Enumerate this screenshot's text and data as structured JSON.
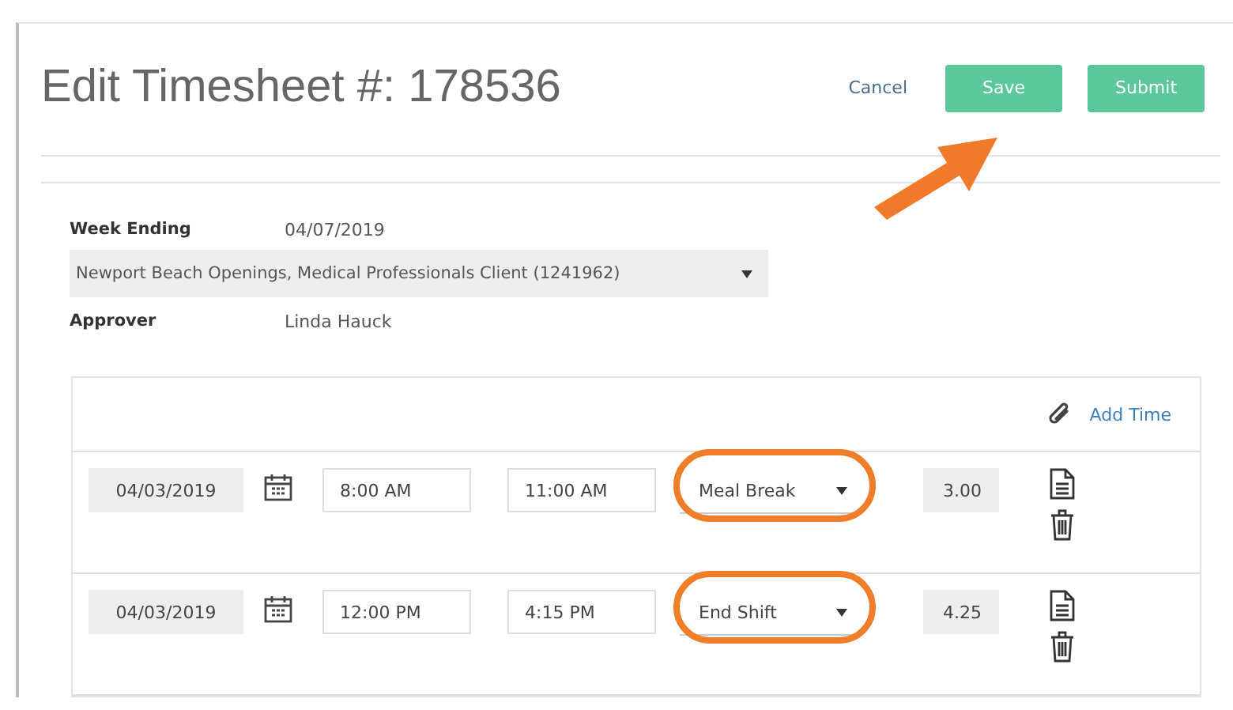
{
  "header": {
    "title": "Edit Timesheet #: 178536",
    "cancel": "Cancel",
    "buttons": [
      "Save",
      "Submit"
    ]
  },
  "details": {
    "week_ending_label": "Week Ending",
    "week_ending": "04/07/2019",
    "assignment": "Newport Beach Openings, Medical Professionals Client (1241962)",
    "approver_label": "Approver",
    "approver": "Linda Hauck"
  },
  "time_entries": {
    "add_time": "Add Time",
    "rows": [
      {
        "date": "04/03/2019",
        "start": "8:00 AM",
        "end": "11:00 AM",
        "type": "Meal Break",
        "hours": "3.00",
        "highlighted": true
      },
      {
        "date": "04/03/2019",
        "start": "12:00 PM",
        "end": "4:15 PM",
        "type": "End Shift",
        "hours": "4.25",
        "highlighted": true
      }
    ]
  },
  "annotation": {
    "arrow": true
  }
}
